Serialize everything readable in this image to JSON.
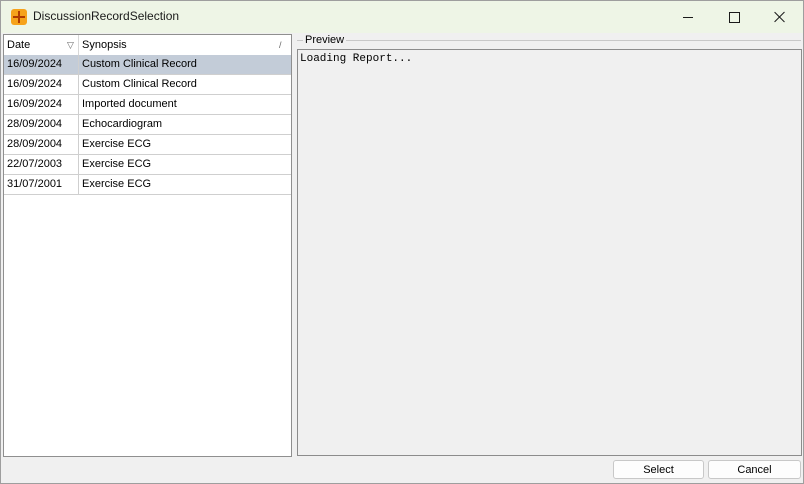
{
  "window": {
    "title": "DiscussionRecordSelection",
    "icons": {
      "app": "app-icon-orange-plus"
    }
  },
  "list": {
    "columns": [
      {
        "label": "Date",
        "sort": "descending"
      },
      {
        "label": "Synopsis",
        "sort": "ascending"
      }
    ],
    "rows": [
      {
        "date": "16/09/2024",
        "synopsis": "Custom Clinical Record",
        "selected": true
      },
      {
        "date": "16/09/2024",
        "synopsis": "Custom Clinical Record",
        "selected": false
      },
      {
        "date": "16/09/2024",
        "synopsis": "Imported document",
        "selected": false
      },
      {
        "date": "28/09/2004",
        "synopsis": "Echocardiogram",
        "selected": false
      },
      {
        "date": "28/09/2004",
        "synopsis": "Exercise ECG",
        "selected": false
      },
      {
        "date": "22/07/2003",
        "synopsis": "Exercise ECG",
        "selected": false
      },
      {
        "date": "31/07/2001",
        "synopsis": "Exercise ECG",
        "selected": false
      }
    ],
    "selected_color": "#c3ccd8"
  },
  "preview": {
    "label": "Preview",
    "text": "Loading Report..."
  },
  "buttons": {
    "select": "Select",
    "cancel": "Cancel"
  }
}
